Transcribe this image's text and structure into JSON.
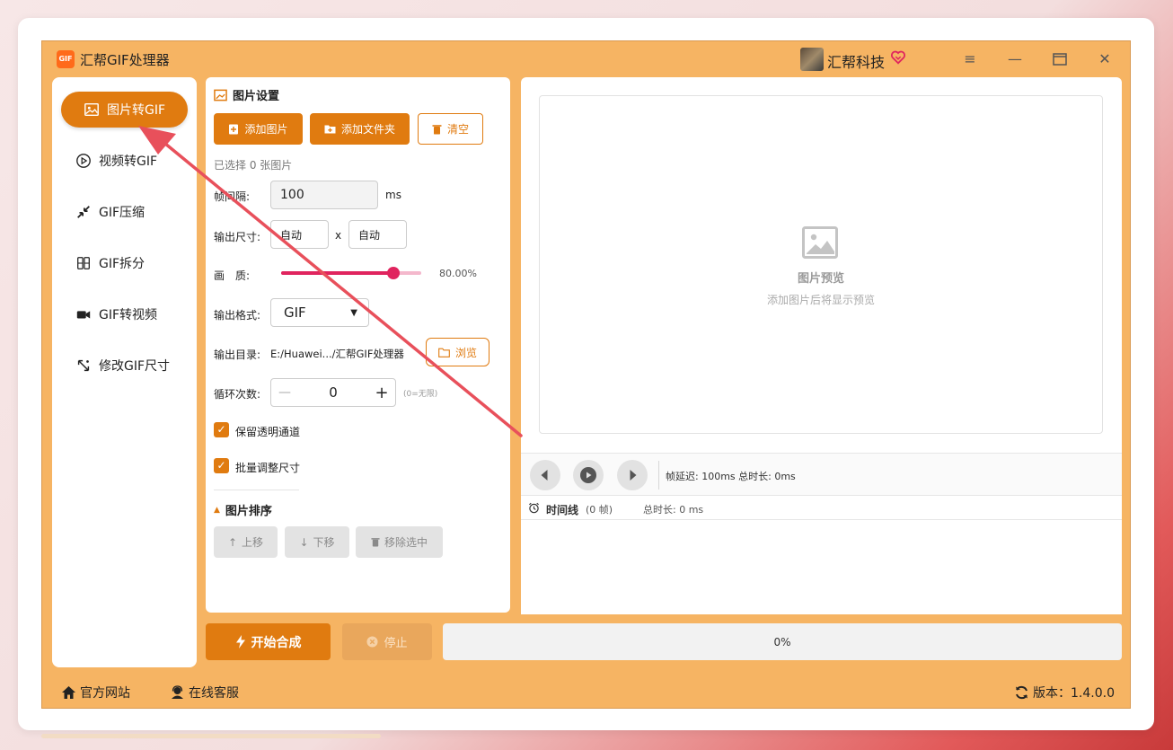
{
  "app": {
    "title": "汇帮GIF处理器",
    "logo_text": "GIF"
  },
  "user": {
    "name": "汇帮科技"
  },
  "sidebar": {
    "items": [
      {
        "label": "图片转GIF",
        "icon": "image-icon",
        "active": true
      },
      {
        "label": "视频转GIF",
        "icon": "play-circle-icon"
      },
      {
        "label": "GIF压缩",
        "icon": "compress-icon"
      },
      {
        "label": "GIF拆分",
        "icon": "split-icon"
      },
      {
        "label": "GIF转视频",
        "icon": "video-camera-icon"
      },
      {
        "label": "修改GIF尺寸",
        "icon": "resize-icon"
      }
    ]
  },
  "settings": {
    "title": "图片设置",
    "add_image": "添加图片",
    "add_folder": "添加文件夹",
    "clear": "清空",
    "selected_text": "已选择 0 张图片",
    "frame_interval_label": "帧间隔:",
    "frame_interval_value": "100",
    "frame_interval_unit": "ms",
    "output_size_label": "输出尺寸:",
    "width_value": "自动",
    "size_separator": "x",
    "height_value": "自动",
    "quality_label": "画　质:",
    "quality_value": "80.00%",
    "quality_fraction": 0.8,
    "format_label": "输出格式:",
    "format_value": "GIF",
    "output_dir_label": "输出目录:",
    "output_dir_value": "E:/Huawei.../汇帮GIF处理器",
    "browse": "浏览",
    "loop_label": "循环次数:",
    "loop_value": "0",
    "loop_hint": "(0=无限)",
    "keep_transparent": "保留透明通道",
    "batch_resize": "批量调整尺寸",
    "sort_title": "图片排序",
    "move_up": "上移",
    "move_down": "下移",
    "remove_selected": "移除选中"
  },
  "preview": {
    "title": "图片预览",
    "subtitle": "添加图片后将显示预览",
    "player_info": "帧延迟: 100ms  总时长: 0ms",
    "timeline_label": "时间线",
    "timeline_count": "(0 帧)",
    "timeline_duration": "总时长: 0 ms"
  },
  "actions": {
    "start": "开始合成",
    "stop": "停止",
    "progress_text": "0%",
    "progress": 0
  },
  "footer": {
    "website": "官方网站",
    "support": "在线客服",
    "version": "版本：1.4.0.0"
  },
  "colors": {
    "accent": "#e07b10",
    "app_background": "#f6b463",
    "slider": "#e0245e",
    "annotation_arrow": "#e8505b"
  }
}
